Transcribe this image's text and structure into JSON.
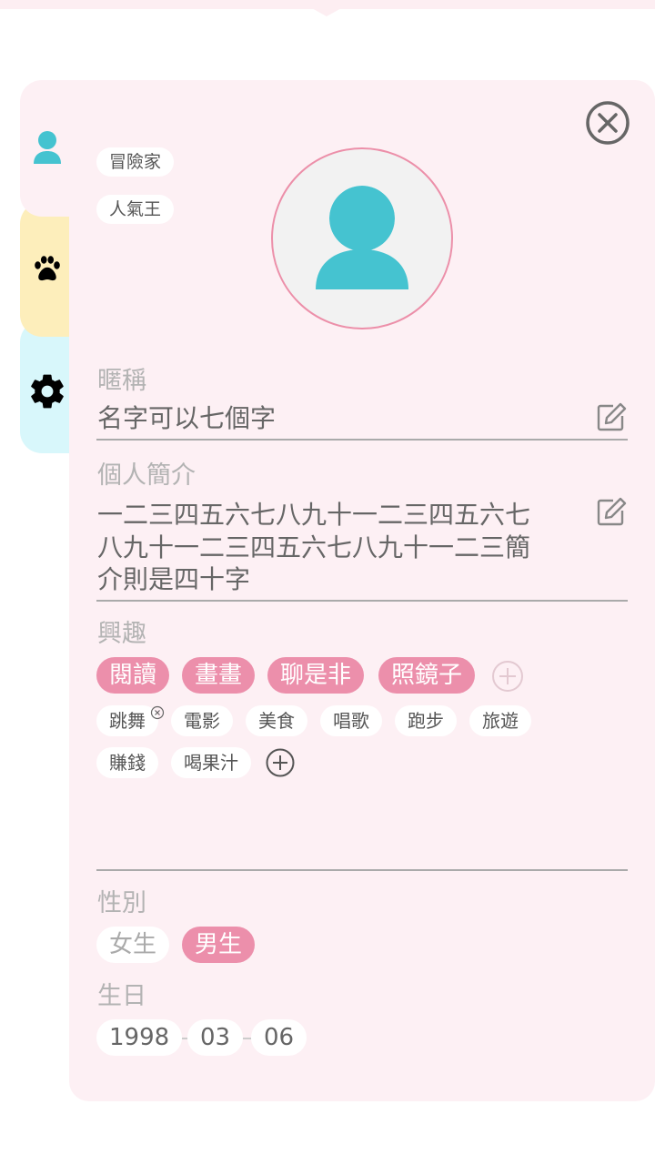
{
  "titles": [
    "冒險家",
    "人氣王"
  ],
  "tabs": [
    {
      "name": "profile",
      "icon": "person-icon"
    },
    {
      "name": "pet",
      "icon": "paw-icon"
    },
    {
      "name": "settings",
      "icon": "gear-icon"
    }
  ],
  "nickname": {
    "label": "暱稱",
    "value": "名字可以七個字"
  },
  "bio": {
    "label": "個人簡介",
    "lines": [
      "一二三四五六七八九十一二三四五六七",
      "八九十一二三四五六七八九十一二三簡",
      "介則是四十字"
    ]
  },
  "interests": {
    "label": "興趣",
    "selected": [
      "閱讀",
      "畫畫",
      "聊是非",
      "照鏡子"
    ],
    "options": [
      "跳舞",
      "電影",
      "美食",
      "唱歌",
      "跑步",
      "旅遊",
      "賺錢",
      "喝果汁"
    ]
  },
  "gender": {
    "label": "性別",
    "options": [
      "女生",
      "男生"
    ],
    "selected": "男生"
  },
  "birthday": {
    "label": "生日",
    "year": "1998",
    "month": "03",
    "day": "06"
  },
  "colors": {
    "accent_pink": "#ec8fab",
    "accent_teal": "#45c3d0",
    "panel_bg": "#fdf0f4"
  }
}
